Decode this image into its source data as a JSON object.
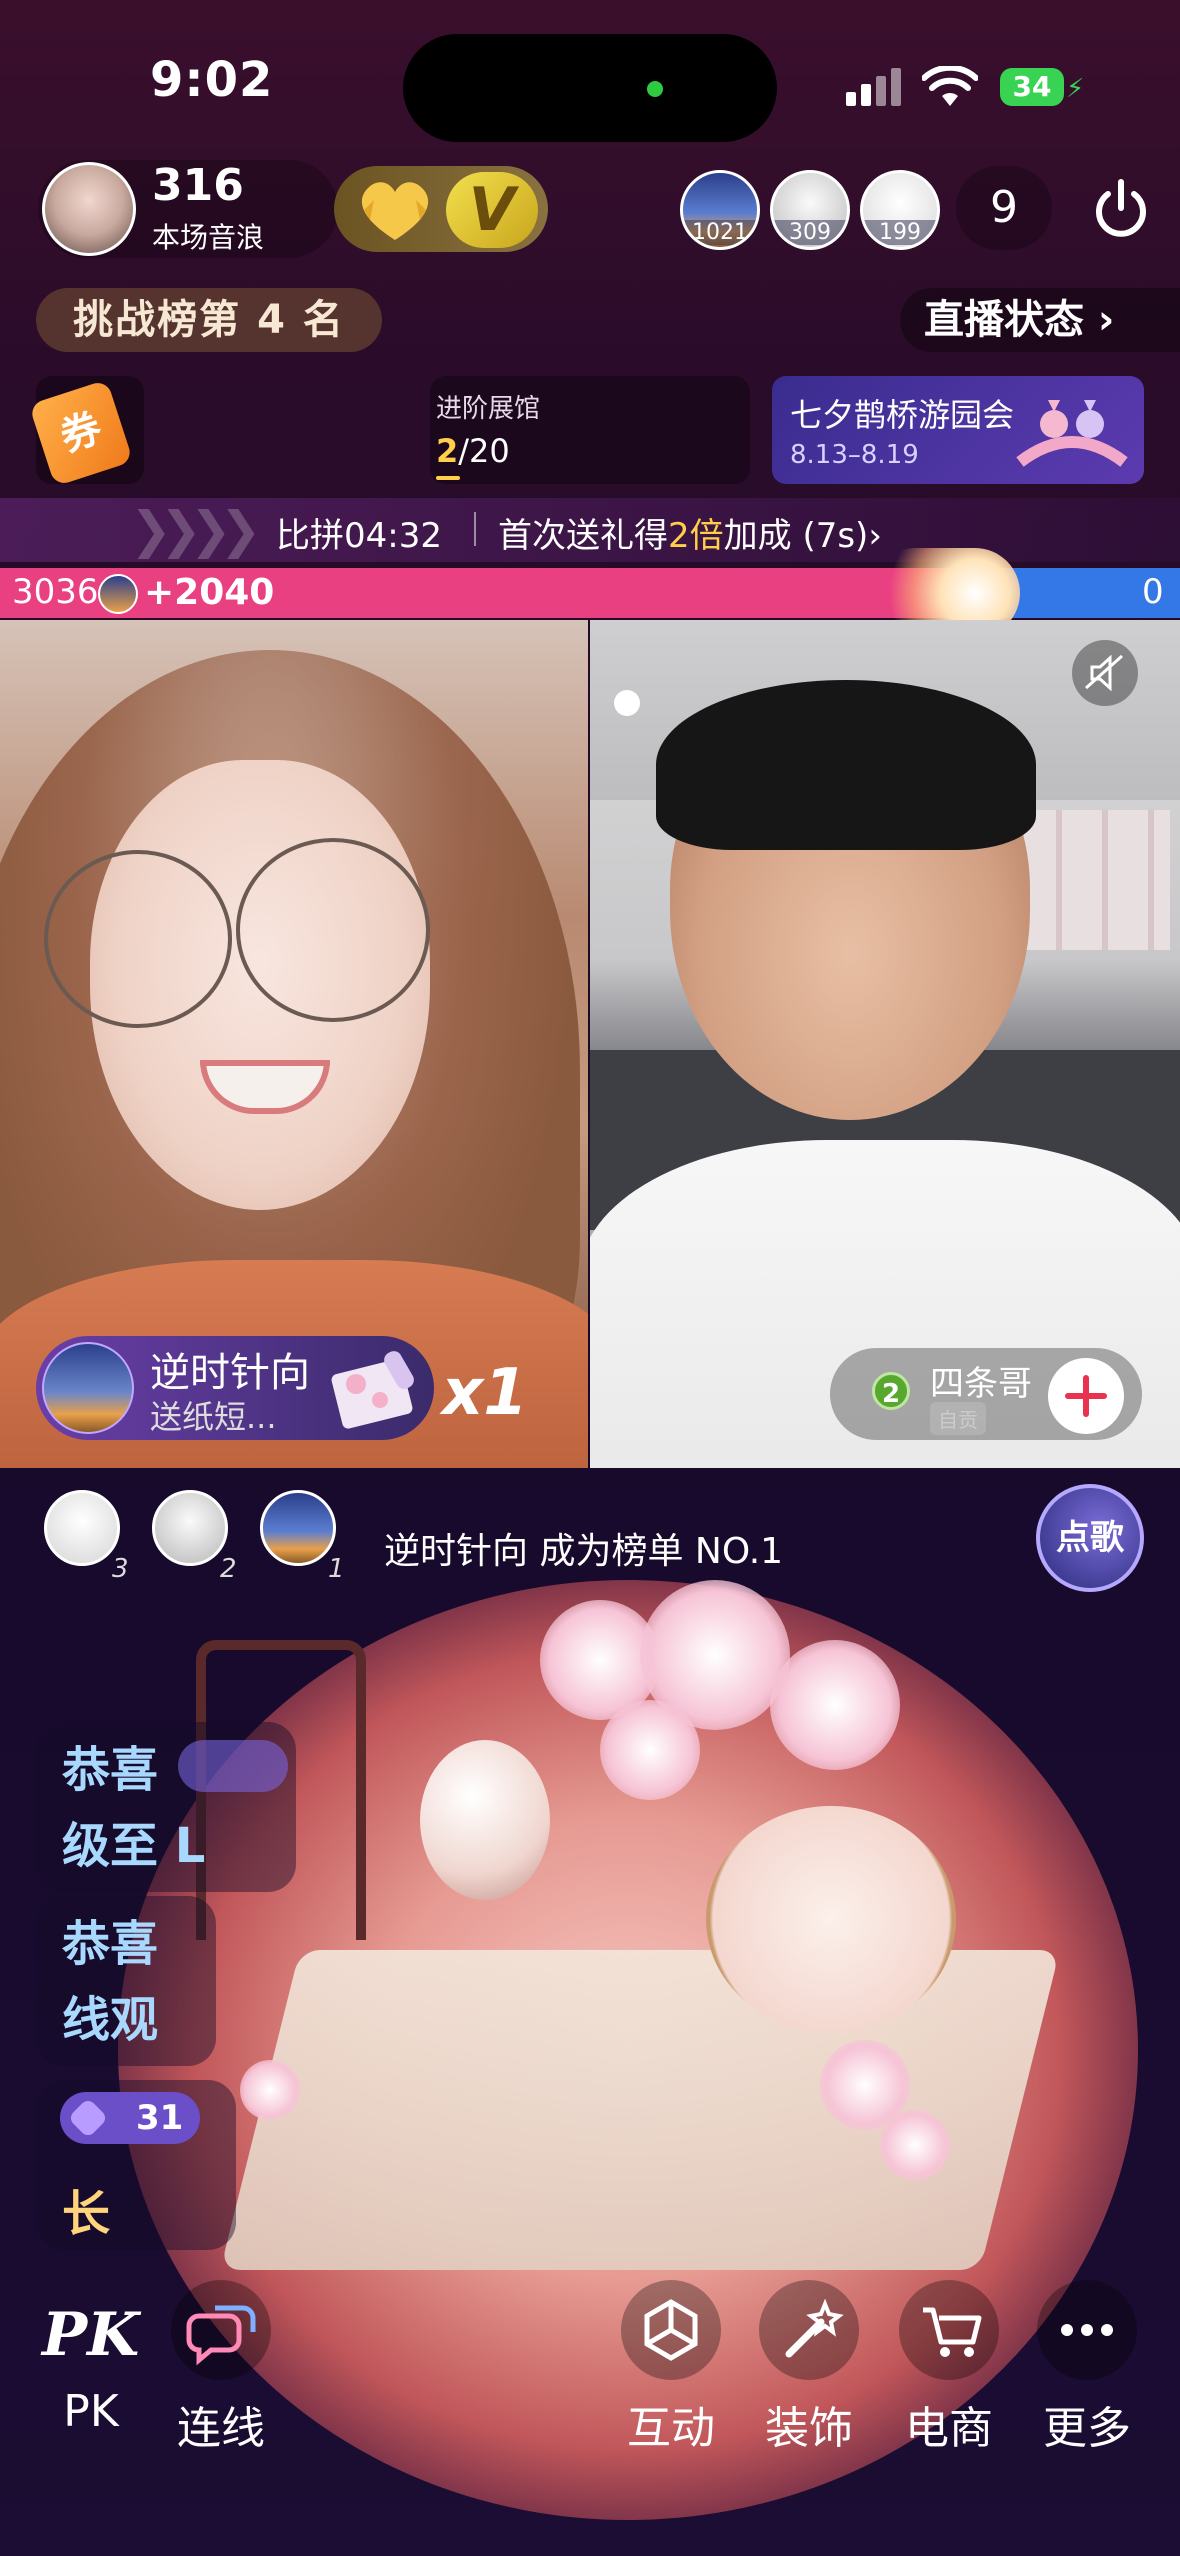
{
  "status_bar": {
    "time": "9:02",
    "battery": "34"
  },
  "host": {
    "score": "316",
    "score_label": "本场音浪",
    "v_label": "V"
  },
  "top_viewers": [
    {
      "name": "viewer-1",
      "num": "1021"
    },
    {
      "name": "viewer-2",
      "num": "309"
    },
    {
      "name": "viewer-3",
      "num": "199"
    }
  ],
  "viewer_count": "9",
  "rank_label": "挑战榜第 4 名",
  "live_status": "直播状态 ›",
  "coupon_label": "券",
  "gallery": {
    "title": "进阶展馆",
    "current": "2",
    "total": "/20"
  },
  "event": {
    "title": "七夕鹊桥游园会",
    "date": "8.13–8.19"
  },
  "pk": {
    "timer": "比拼04:32",
    "tip_prefix": "首次送礼得",
    "tip_highlight": "2倍",
    "tip_suffix": "加成 (7s)›",
    "left_score": "3036",
    "left_gain": "+2040",
    "right_score": "0"
  },
  "gift": {
    "sender": "逆时针向",
    "desc": "送纸短...",
    "count": "x1"
  },
  "opponent": {
    "level": "2",
    "name": "四条哥",
    "tag": "自贡"
  },
  "ranking": {
    "ranks": [
      "3",
      "2",
      "1"
    ],
    "message": "逆时针向 成为榜单 NO.1",
    "song_button": "点歌"
  },
  "chat": {
    "line1a": "恭喜",
    "line1b": "级至 L",
    "line2a": "恭喜",
    "line2b": "线观",
    "chip": "31",
    "line3": "长"
  },
  "toolbar": {
    "pk_logo": "PK",
    "pk": "PK",
    "connect": "连线",
    "interact": "互动",
    "decorate": "装饰",
    "shop": "电商",
    "more": "更多"
  },
  "colors": {
    "pk_pink": "#e84080",
    "pk_blue": "#3477e6",
    "accent_gold": "#ffce4a"
  }
}
